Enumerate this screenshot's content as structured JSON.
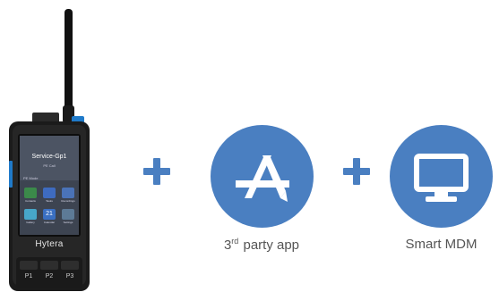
{
  "device": {
    "brand": "Hytera",
    "screen_title": "Service-Gp1",
    "screen_subtitle": "PE Call",
    "screen_status": "PE Mode",
    "apps": [
      "Contacts",
      "Tasks",
      "Recordings",
      "Gallery",
      "Calendar",
      "Settings"
    ],
    "calendar_day": "21",
    "keys": [
      "P1",
      "P2",
      "P3"
    ]
  },
  "features": [
    {
      "label_prefix": "3",
      "label_sup": "rd",
      "label_rest": " party app",
      "icon": "app-store-icon"
    },
    {
      "label": "Smart MDM",
      "icon": "monitor-icon"
    }
  ],
  "colors": {
    "accent": "#4a7fc1",
    "text": "#555555"
  }
}
